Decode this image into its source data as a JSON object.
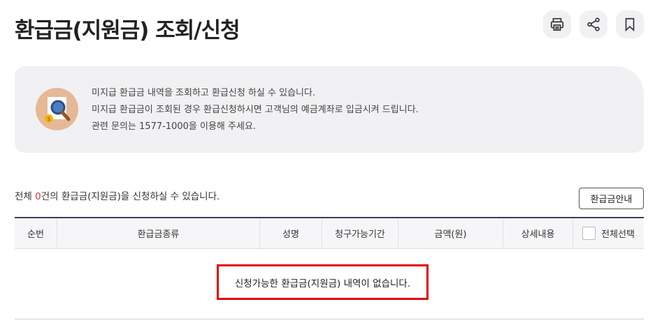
{
  "page": {
    "title": "환급금(지원금) 조회/신청"
  },
  "toolbar": {
    "print_icon": "printer-icon",
    "share_icon": "share-icon",
    "bookmark_icon": "bookmark-icon"
  },
  "info": {
    "icon": "magnifier-coin-icon",
    "lines": [
      "미지급 환급금 내역을 조회하고 환급신청 하실 수 있습니다.",
      "미지급 환급금이 조회된 경우 환급신청하시면 고객님의 예금계좌로 입금시켜 드립니다.",
      "관련 문의는 1577-1000을 이용해 주세요."
    ]
  },
  "summary": {
    "prefix": "전체 ",
    "count": "0",
    "suffix": "건의 환급금(지원금)을 신청하실 수 있습니다."
  },
  "guide_button": "환급금안내",
  "table": {
    "headers": [
      "순번",
      "환급금종류",
      "성명",
      "청구가능기간",
      "금액(원)",
      "상세내용",
      "전체선택"
    ],
    "empty_message": "신청가능한 환급금(지원금) 내역이 없습니다."
  },
  "colors": {
    "accent_red": "#e03030",
    "highlight_border": "#e10000",
    "table_top_border": "#3a3f5c",
    "info_bg": "#f1f1f3"
  }
}
